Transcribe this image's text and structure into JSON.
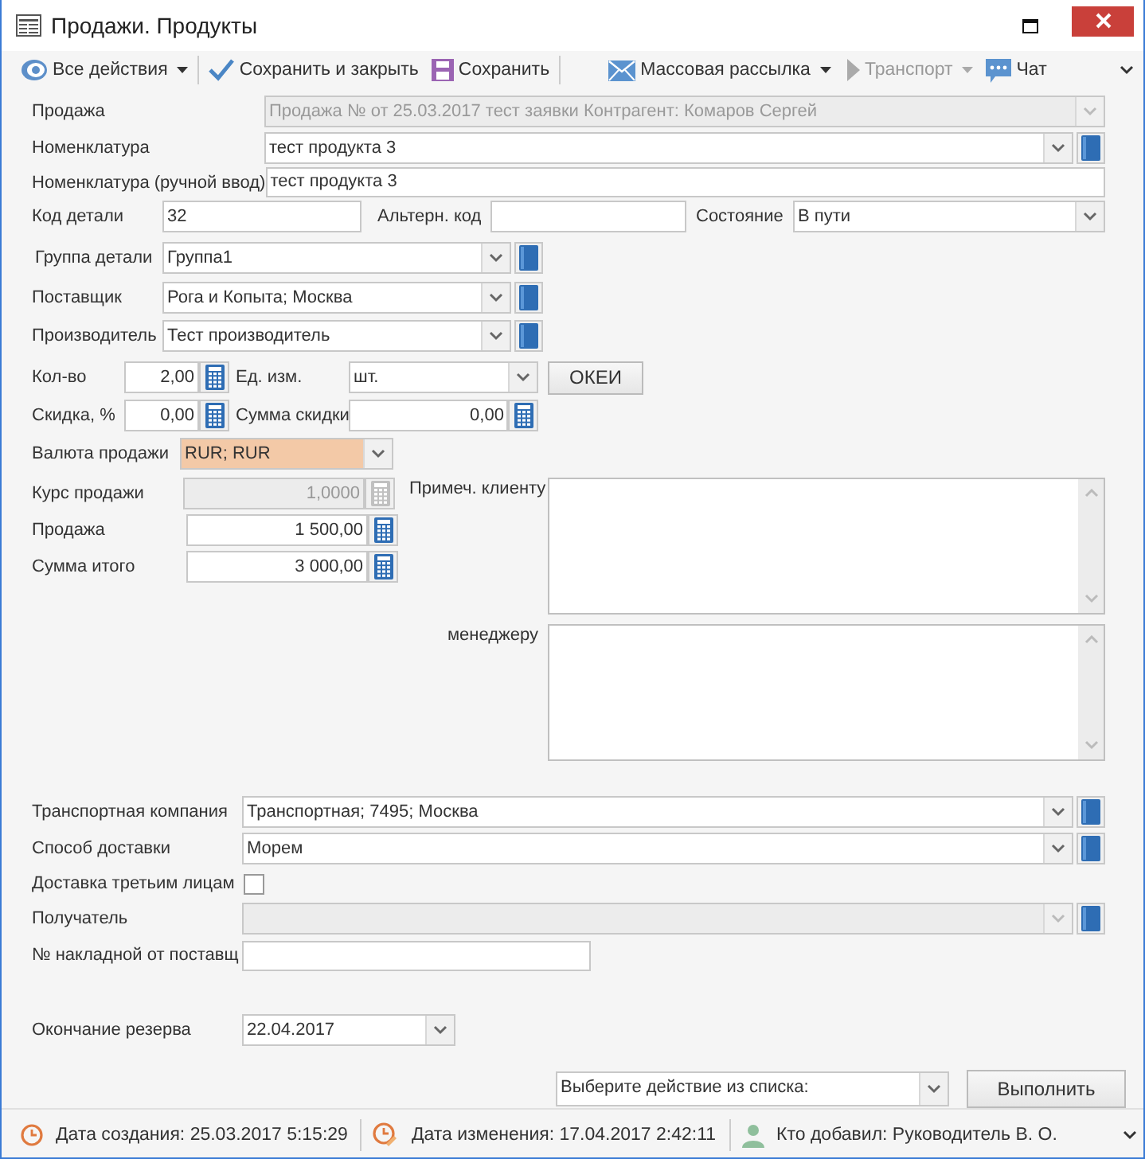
{
  "window": {
    "title": "Продажи. Продукты"
  },
  "toolbar": [
    {
      "label": "Все действия",
      "dropdown": true,
      "disabled": false
    },
    {
      "label": "Сохранить и закрыть",
      "dropdown": false,
      "disabled": false
    },
    {
      "label": "Сохранить",
      "dropdown": false,
      "disabled": false
    },
    {
      "label": "Массовая рассылка",
      "dropdown": true,
      "disabled": false
    },
    {
      "label": "Транспорт",
      "dropdown": true,
      "disabled": true
    },
    {
      "label": "Чат",
      "dropdown": false,
      "disabled": false
    }
  ],
  "sale": {
    "label": "Продажа",
    "value": "Продажа №   от 25.03.2017 тест заявки Контрагент: Комаров Сергей",
    "disabled": true
  },
  "nomenclature": {
    "label": "Номенклатура",
    "value": "тест продукта 3"
  },
  "nomenclature_manual": {
    "label": "Номенклатура (ручной ввод)",
    "value": "тест продукта 3"
  },
  "part_code": {
    "label": "Код детали",
    "value": "32"
  },
  "alt_code": {
    "label": "Альтерн. код"
  },
  "state": {
    "label": "Состояние",
    "value": "В пути"
  },
  "part_group": {
    "label": "Группа детали",
    "value": "Группа1"
  },
  "supplier": {
    "label": "Поставщик",
    "value": "Рога и Копыта; Москва"
  },
  "manufacturer": {
    "label": "Производитель",
    "value": "Тест производитель"
  },
  "quantity": {
    "label": "Кол-во",
    "value": "2,00"
  },
  "unit": {
    "label": "Ед. изм.",
    "value": "шт."
  },
  "okei_button": "ОКЕИ",
  "discount": {
    "label": "Скидка, %",
    "value": "0,00"
  },
  "discount_sum": {
    "label": "Сумма скидки",
    "value": "0,00"
  },
  "currency": {
    "label": "Валюта продажи",
    "value": "RUR; RUR",
    "highlighted": true
  },
  "rate": {
    "label": "Курс продажи",
    "value": "1,0000",
    "disabled": true
  },
  "price": {
    "label": "Продажа",
    "value": "1 500,00"
  },
  "total": {
    "label": "Сумма итого",
    "value": "3 000,00"
  },
  "note_client": {
    "label": "Примеч. клиенту"
  },
  "note_manager": {
    "label": "менеджеру"
  },
  "transport_company": {
    "label": "Транспортная компания",
    "value": "Транспортная; 7495; Москва"
  },
  "delivery_method": {
    "label": "Способ доставки",
    "value": "Морем"
  },
  "third_party": {
    "label": "Доставка третьим лицам",
    "checked": false
  },
  "recipient": {
    "label": "Получатель",
    "disabled": true
  },
  "invoice_no": {
    "label": "№ накладной от поставщ"
  },
  "reserve_end": {
    "label": "Окончание резерва",
    "value": "22.04.2017"
  },
  "action_select": {
    "value": "Выберите действие из списка:"
  },
  "run_button": "Выполнить",
  "status_bar": [
    {
      "text": "Дата создания: 25.03.2017 5:15:29"
    },
    {
      "text": "Дата изменения: 17.04.2017 2:42:11"
    },
    {
      "text": "Кто добавил: Руководитель В. О."
    }
  ]
}
